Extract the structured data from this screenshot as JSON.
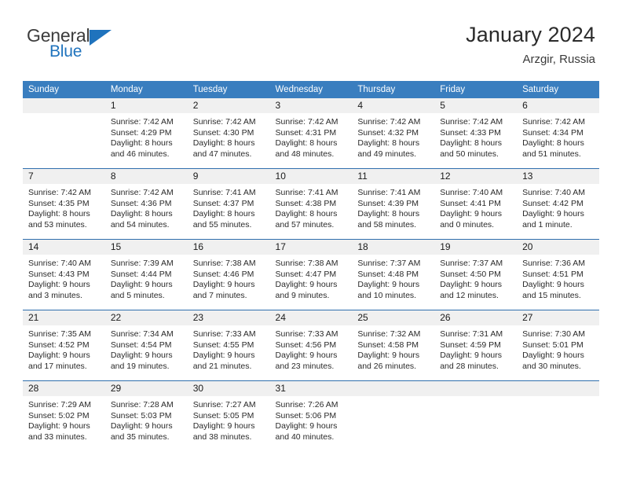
{
  "brand": {
    "word1": "General",
    "word2": "Blue",
    "accent_color": "#1f73bd",
    "triangle_icon": "triangle-icon"
  },
  "header": {
    "title": "January 2024",
    "location": "Arzgir, Russia"
  },
  "calendar": {
    "header_bg": "#3a7ebf",
    "daynum_bg": "#f0f0f0",
    "weekday_names": [
      "Sunday",
      "Monday",
      "Tuesday",
      "Wednesday",
      "Thursday",
      "Friday",
      "Saturday"
    ],
    "weeks": [
      [
        {
          "day": "",
          "detail": "",
          "empty": true
        },
        {
          "day": "1",
          "detail": "Sunrise: 7:42 AM\nSunset: 4:29 PM\nDaylight: 8 hours\nand 46 minutes."
        },
        {
          "day": "2",
          "detail": "Sunrise: 7:42 AM\nSunset: 4:30 PM\nDaylight: 8 hours\nand 47 minutes."
        },
        {
          "day": "3",
          "detail": "Sunrise: 7:42 AM\nSunset: 4:31 PM\nDaylight: 8 hours\nand 48 minutes."
        },
        {
          "day": "4",
          "detail": "Sunrise: 7:42 AM\nSunset: 4:32 PM\nDaylight: 8 hours\nand 49 minutes."
        },
        {
          "day": "5",
          "detail": "Sunrise: 7:42 AM\nSunset: 4:33 PM\nDaylight: 8 hours\nand 50 minutes."
        },
        {
          "day": "6",
          "detail": "Sunrise: 7:42 AM\nSunset: 4:34 PM\nDaylight: 8 hours\nand 51 minutes."
        }
      ],
      [
        {
          "day": "7",
          "detail": "Sunrise: 7:42 AM\nSunset: 4:35 PM\nDaylight: 8 hours\nand 53 minutes."
        },
        {
          "day": "8",
          "detail": "Sunrise: 7:42 AM\nSunset: 4:36 PM\nDaylight: 8 hours\nand 54 minutes."
        },
        {
          "day": "9",
          "detail": "Sunrise: 7:41 AM\nSunset: 4:37 PM\nDaylight: 8 hours\nand 55 minutes."
        },
        {
          "day": "10",
          "detail": "Sunrise: 7:41 AM\nSunset: 4:38 PM\nDaylight: 8 hours\nand 57 minutes."
        },
        {
          "day": "11",
          "detail": "Sunrise: 7:41 AM\nSunset: 4:39 PM\nDaylight: 8 hours\nand 58 minutes."
        },
        {
          "day": "12",
          "detail": "Sunrise: 7:40 AM\nSunset: 4:41 PM\nDaylight: 9 hours\nand 0 minutes."
        },
        {
          "day": "13",
          "detail": "Sunrise: 7:40 AM\nSunset: 4:42 PM\nDaylight: 9 hours\nand 1 minute."
        }
      ],
      [
        {
          "day": "14",
          "detail": "Sunrise: 7:40 AM\nSunset: 4:43 PM\nDaylight: 9 hours\nand 3 minutes."
        },
        {
          "day": "15",
          "detail": "Sunrise: 7:39 AM\nSunset: 4:44 PM\nDaylight: 9 hours\nand 5 minutes."
        },
        {
          "day": "16",
          "detail": "Sunrise: 7:38 AM\nSunset: 4:46 PM\nDaylight: 9 hours\nand 7 minutes."
        },
        {
          "day": "17",
          "detail": "Sunrise: 7:38 AM\nSunset: 4:47 PM\nDaylight: 9 hours\nand 9 minutes."
        },
        {
          "day": "18",
          "detail": "Sunrise: 7:37 AM\nSunset: 4:48 PM\nDaylight: 9 hours\nand 10 minutes."
        },
        {
          "day": "19",
          "detail": "Sunrise: 7:37 AM\nSunset: 4:50 PM\nDaylight: 9 hours\nand 12 minutes."
        },
        {
          "day": "20",
          "detail": "Sunrise: 7:36 AM\nSunset: 4:51 PM\nDaylight: 9 hours\nand 15 minutes."
        }
      ],
      [
        {
          "day": "21",
          "detail": "Sunrise: 7:35 AM\nSunset: 4:52 PM\nDaylight: 9 hours\nand 17 minutes."
        },
        {
          "day": "22",
          "detail": "Sunrise: 7:34 AM\nSunset: 4:54 PM\nDaylight: 9 hours\nand 19 minutes."
        },
        {
          "day": "23",
          "detail": "Sunrise: 7:33 AM\nSunset: 4:55 PM\nDaylight: 9 hours\nand 21 minutes."
        },
        {
          "day": "24",
          "detail": "Sunrise: 7:33 AM\nSunset: 4:56 PM\nDaylight: 9 hours\nand 23 minutes."
        },
        {
          "day": "25",
          "detail": "Sunrise: 7:32 AM\nSunset: 4:58 PM\nDaylight: 9 hours\nand 26 minutes."
        },
        {
          "day": "26",
          "detail": "Sunrise: 7:31 AM\nSunset: 4:59 PM\nDaylight: 9 hours\nand 28 minutes."
        },
        {
          "day": "27",
          "detail": "Sunrise: 7:30 AM\nSunset: 5:01 PM\nDaylight: 9 hours\nand 30 minutes."
        }
      ],
      [
        {
          "day": "28",
          "detail": "Sunrise: 7:29 AM\nSunset: 5:02 PM\nDaylight: 9 hours\nand 33 minutes."
        },
        {
          "day": "29",
          "detail": "Sunrise: 7:28 AM\nSunset: 5:03 PM\nDaylight: 9 hours\nand 35 minutes."
        },
        {
          "day": "30",
          "detail": "Sunrise: 7:27 AM\nSunset: 5:05 PM\nDaylight: 9 hours\nand 38 minutes."
        },
        {
          "day": "31",
          "detail": "Sunrise: 7:26 AM\nSunset: 5:06 PM\nDaylight: 9 hours\nand 40 minutes."
        },
        {
          "day": "",
          "detail": "",
          "empty": true
        },
        {
          "day": "",
          "detail": "",
          "empty": true
        },
        {
          "day": "",
          "detail": "",
          "empty": true
        }
      ]
    ]
  }
}
